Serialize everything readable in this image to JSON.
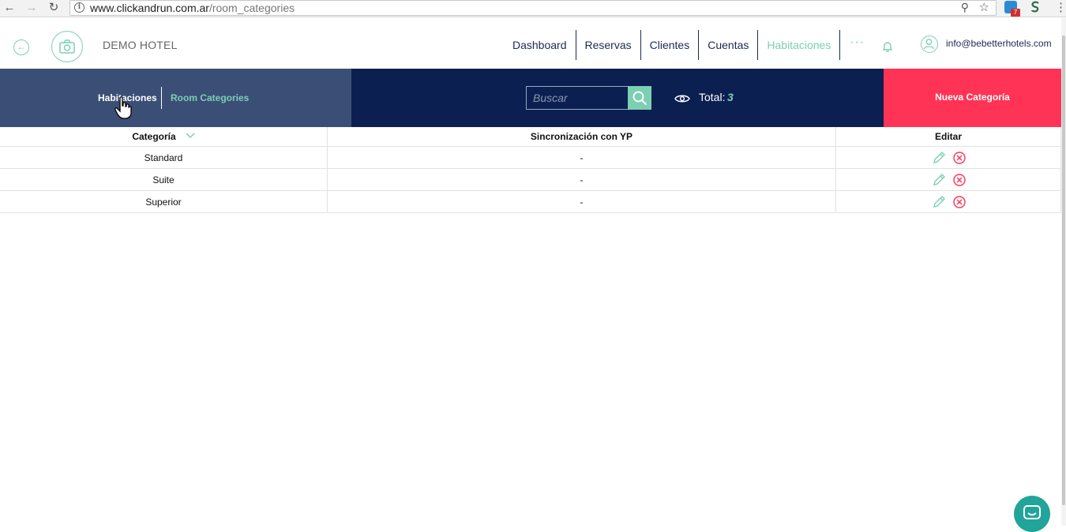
{
  "browser": {
    "url_domain": "www.clickandrun.com.ar",
    "url_path": "/room_categories",
    "extension_badge": "7"
  },
  "header": {
    "hotel_name": "DEMO HOTEL",
    "nav": [
      "Dashboard",
      "Reservas",
      "Clientes",
      "Cuentas",
      "Habitaciones"
    ],
    "active_nav": "Habitaciones",
    "more": "···",
    "user_email": "info@bebetterhotels.com"
  },
  "toolbar": {
    "subnav_rooms": "Habitaciones",
    "subnav_categories": "Room Categories",
    "search_placeholder": "Buscar",
    "total_label": "Total:",
    "total_value": "3",
    "new_category_label": "Nueva Categoría"
  },
  "table": {
    "columns": [
      "Categoría",
      "Sincronización con YP",
      "Editar"
    ],
    "rows": [
      {
        "category": "Standard",
        "sync": "-"
      },
      {
        "category": "Suite",
        "sync": "-"
      },
      {
        "category": "Superior",
        "sync": "-"
      }
    ]
  },
  "colors": {
    "accent": "#7ccfb2",
    "navy": "#0b1f51",
    "slate": "#3b4f76",
    "danger": "#ff3355"
  }
}
